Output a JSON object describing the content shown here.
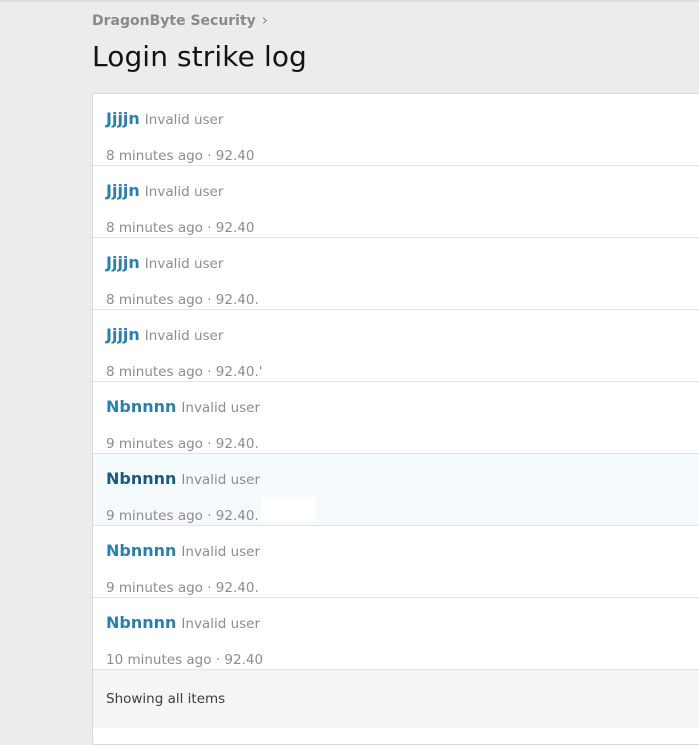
{
  "breadcrumb": {
    "label": "DragonByte Security",
    "chevron": "›"
  },
  "page": {
    "title": "Login strike log"
  },
  "log": {
    "rows": [
      {
        "user": "Jjjjn",
        "reason": "Invalid user",
        "time": "8 minutes ago",
        "sep": " · ",
        "ip": "92.40",
        "highlighted": false
      },
      {
        "user": "Jjjjn",
        "reason": "Invalid user",
        "time": "8 minutes ago",
        "sep": " · ",
        "ip": "92.40",
        "highlighted": false
      },
      {
        "user": "Jjjjn",
        "reason": "Invalid user",
        "time": "8 minutes ago",
        "sep": " · ",
        "ip": "92.40.",
        "highlighted": false
      },
      {
        "user": "Jjjjn",
        "reason": "Invalid user",
        "time": "8 minutes ago",
        "sep": " · ",
        "ip": "92.40.'",
        "highlighted": false
      },
      {
        "user": "Nbnnnn",
        "reason": "Invalid user",
        "time": "9 minutes ago",
        "sep": " · ",
        "ip": "92.40.",
        "highlighted": false
      },
      {
        "user": "Nbnnnn",
        "reason": "Invalid user",
        "time": "9 minutes ago",
        "sep": " · ",
        "ip": "92.40.",
        "highlighted": true
      },
      {
        "user": "Nbnnnn",
        "reason": "Invalid user",
        "time": "9 minutes ago",
        "sep": " · ",
        "ip": "92.40.",
        "highlighted": false
      },
      {
        "user": "Nbnnnn",
        "reason": "Invalid user",
        "time": "10 minutes ago",
        "sep": " · ",
        "ip": "92.40",
        "highlighted": false
      }
    ],
    "footer": "Showing all items"
  },
  "colors": {
    "link": "#2b7fad",
    "link_hover": "#185a80",
    "muted": "#8c8c8c",
    "page_bg": "#ececec"
  },
  "icons": {
    "breadcrumb_separator": "chevron-right-icon"
  }
}
